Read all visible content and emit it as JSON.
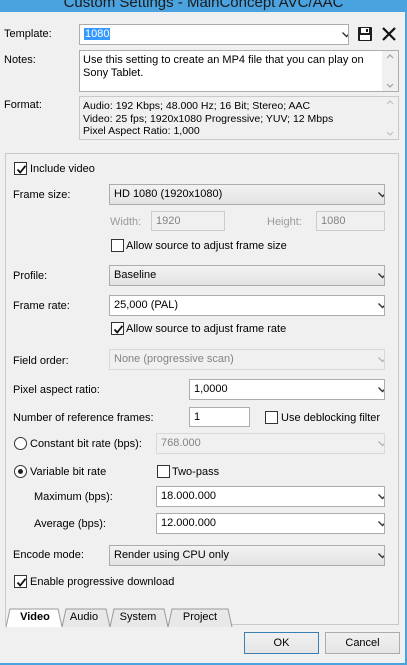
{
  "window": {
    "title": "Custom Settings - MainConcept AVC/AAC"
  },
  "template": {
    "label": "Template:",
    "value": "1080",
    "save_icon": "floppy-disk-icon",
    "delete_icon": "close-icon"
  },
  "notes": {
    "label": "Notes:",
    "text": "Use this setting to create an MP4 file that you can play on Sony Tablet."
  },
  "format": {
    "label": "Format:",
    "lines": [
      "Audio: 192 Kbps; 48.000 Hz; 16 Bit; Stereo; AAC",
      "Video: 25 fps; 1920x1080 Progressive; YUV; 12 Mbps",
      "Pixel Aspect Ratio: 1,000"
    ]
  },
  "video": {
    "include_video": {
      "label": "Include video",
      "checked": true
    },
    "frame_size": {
      "label": "Frame size:",
      "value": "HD 1080 (1920x1080)"
    },
    "width": {
      "label": "Width:",
      "value": "1920"
    },
    "height": {
      "label": "Height:",
      "value": "1080"
    },
    "allow_frame_size": {
      "label": "Allow source to adjust frame size",
      "checked": false
    },
    "profile": {
      "label": "Profile:",
      "value": "Baseline"
    },
    "frame_rate": {
      "label": "Frame rate:",
      "value": "25,000 (PAL)"
    },
    "allow_frame_rate": {
      "label": "Allow source to adjust frame rate",
      "checked": true
    },
    "field_order": {
      "label": "Field order:",
      "value": "None (progressive scan)"
    },
    "pixel_aspect": {
      "label": "Pixel aspect ratio:",
      "value": "1,0000"
    },
    "ref_frames": {
      "label": "Number of reference frames:",
      "value": "1"
    },
    "deblocking": {
      "label": "Use deblocking filter",
      "checked": false
    },
    "constant_bitrate": {
      "label": "Constant bit rate (bps):",
      "value": "768.000",
      "selected": false
    },
    "variable_bitrate": {
      "label": "Variable bit rate",
      "selected": true
    },
    "two_pass": {
      "label": "Two-pass",
      "checked": false
    },
    "maximum": {
      "label": "Maximum (bps):",
      "value": "18.000.000"
    },
    "average": {
      "label": "Average (bps):",
      "value": "12.000.000"
    },
    "encode_mode": {
      "label": "Encode mode:",
      "value": "Render using CPU only"
    },
    "progressive_download": {
      "label": "Enable progressive download",
      "checked": true
    }
  },
  "tabs": [
    {
      "label": "Video",
      "active": true
    },
    {
      "label": "Audio",
      "active": false
    },
    {
      "label": "System",
      "active": false
    },
    {
      "label": "Project",
      "active": false
    }
  ],
  "buttons": {
    "ok": "OK",
    "cancel": "Cancel"
  },
  "colors": {
    "titlebar": "#4aa3df",
    "selection": "#3399ff",
    "default_button_border": "#3c7fb1"
  }
}
